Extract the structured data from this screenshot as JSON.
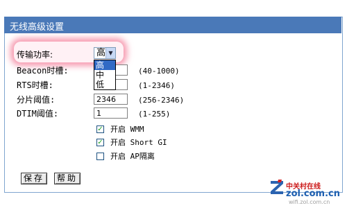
{
  "window": {
    "title": "无线高级设置"
  },
  "form": {
    "tx_power": {
      "label": "传输功率:",
      "value": "高",
      "options": [
        "高",
        "中",
        "低"
      ],
      "selected_index": 0
    },
    "beacon": {
      "label": "Beacon时槽:",
      "value": "",
      "range": "(40-1000)"
    },
    "rts": {
      "label": "RTS时槽:",
      "value": "",
      "range": "(1-2346)"
    },
    "frag": {
      "label": "分片阈值:",
      "value": "2346",
      "range": "(256-2346)"
    },
    "dtim": {
      "label": "DTIM阈值:",
      "value": "1",
      "range": "(1-255)"
    },
    "wmm": {
      "label": "开启 WMM",
      "checked": true
    },
    "short_gi": {
      "label": "开启 Short GI",
      "checked": true
    },
    "ap_isolation": {
      "label": "开启 AP隔离",
      "checked": false
    }
  },
  "buttons": {
    "save": "保存",
    "help": "帮助"
  },
  "watermark": {
    "brand_cn": "中关村在线",
    "brand_en": "zol.com.cn",
    "url": "wifi.zol.com.cn"
  },
  "colors": {
    "titlebar": "#4a79b8",
    "highlight": "#ee466e",
    "check": "#21a121"
  }
}
